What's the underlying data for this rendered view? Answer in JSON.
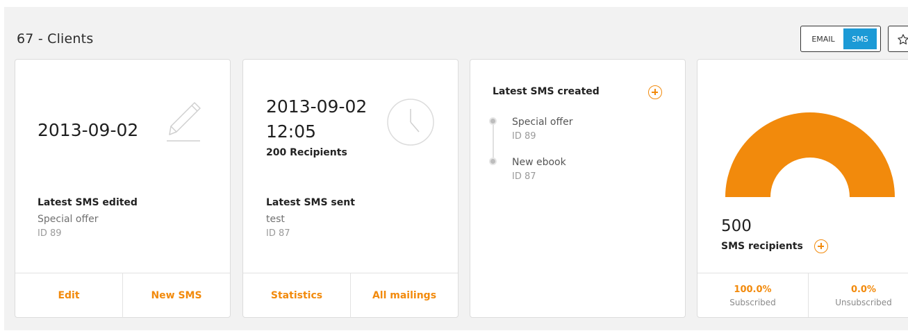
{
  "header": {
    "title": "67 - Clients",
    "toggle": {
      "email_label": "EMAIL",
      "sms_label": "SMS",
      "active": "SMS"
    }
  },
  "colors": {
    "accent": "#f28a0c",
    "toggle_active": "#1c9ad6",
    "background": "#f2f2f2"
  },
  "card_edited": {
    "date": "2013-09-02",
    "icon": "pencil-icon",
    "label": "Latest SMS edited",
    "name": "Special offer",
    "id": "ID 89",
    "actions": [
      "Edit",
      "New SMS"
    ]
  },
  "card_sent": {
    "date": "2013-09-02",
    "time": "12:05",
    "recipients": "200 Recipients",
    "icon": "clock-icon",
    "label": "Latest SMS sent",
    "name": "test",
    "id": "ID 87",
    "actions": [
      "Statistics",
      "All mailings"
    ]
  },
  "card_created": {
    "title": "Latest SMS created",
    "items": [
      {
        "name": "Special offer",
        "id": "ID 89"
      },
      {
        "name": "New ebook",
        "id": "ID 87"
      }
    ]
  },
  "card_recipients": {
    "count": "500",
    "label": "SMS recipients",
    "subscribed_fraction": 1.0,
    "stats": [
      {
        "value": "100.0%",
        "label": "Subscribed"
      },
      {
        "value": "0.0%",
        "label": "Unsubscribed"
      }
    ]
  }
}
